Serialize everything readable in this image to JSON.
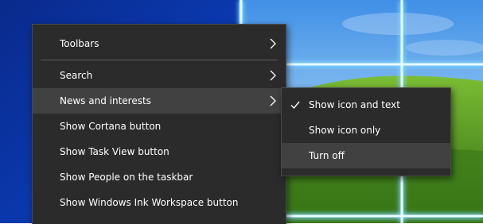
{
  "context_menu": {
    "items": [
      {
        "label": "Toolbars"
      },
      {
        "label": "Search"
      },
      {
        "label": "News and interests"
      },
      {
        "label": "Show Cortana button"
      },
      {
        "label": "Show Task View button"
      },
      {
        "label": "Show People on the taskbar"
      },
      {
        "label": "Show Windows Ink Workspace button"
      }
    ]
  },
  "submenu": {
    "items": [
      {
        "label": "Show icon and text",
        "checked": true
      },
      {
        "label": "Show icon only",
        "checked": false
      },
      {
        "label": "Turn off",
        "checked": false
      }
    ]
  },
  "colors": {
    "menu_bg": "#2b2b2b",
    "hover_bg": "#414141",
    "text": "#ffffff",
    "desktop_blue": "#0c4ed6",
    "glow": "#7fd7ff",
    "grass": "#4f8f1f"
  },
  "icons": {
    "submenu_arrow": "chevron-right-icon",
    "checked": "checkmark-icon"
  }
}
